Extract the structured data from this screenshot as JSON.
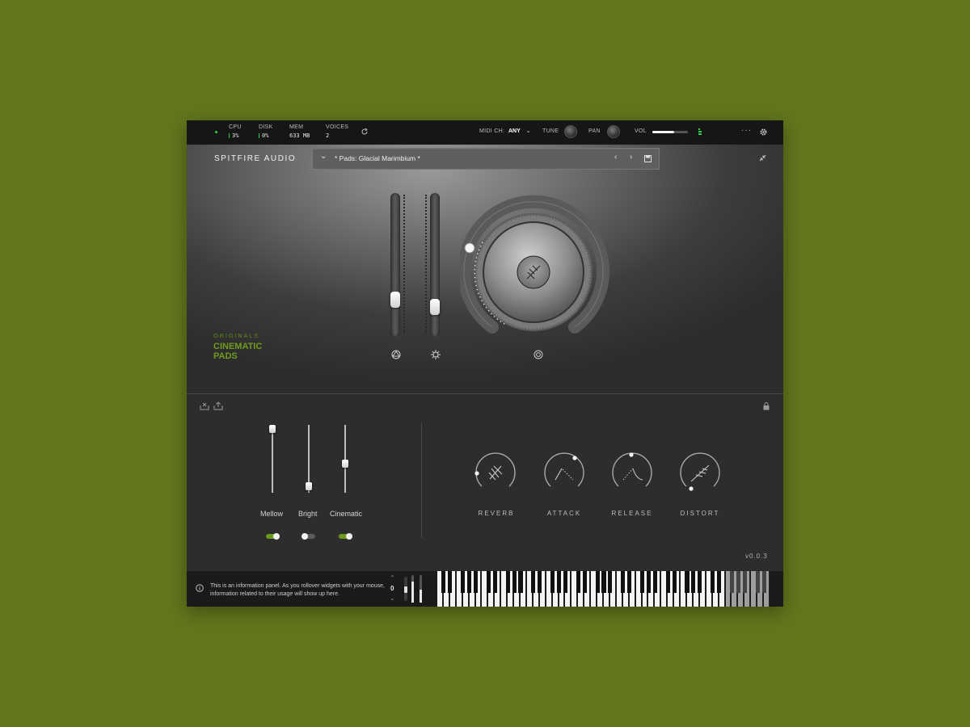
{
  "topbar": {
    "cpu_label": "CPU",
    "cpu_value": "3%",
    "disk_label": "DISK",
    "disk_value": "0%",
    "mem_label": "MEM",
    "mem_value": "633 MB",
    "voices_label": "VOICES",
    "voices_value": "2",
    "midi_label": "MIDI CH:",
    "midi_value": "ANY",
    "tune_label": "TUNE",
    "pan_label": "PAN",
    "vol_label": "VOL",
    "vol_level": 0.62,
    "more_icon": "ellipsis-icon"
  },
  "header": {
    "brand": "SPITFIRE AUDIO",
    "preset_name": "* Pads: Glacial Marimbium *"
  },
  "product": {
    "line1": "ORIGINALS",
    "line2": "CINEMATIC",
    "line3": "PADS"
  },
  "macro_sliders": [
    {
      "name": "expression",
      "level": 0.23
    },
    {
      "name": "dynamics",
      "level": 0.17
    }
  ],
  "mix_sliders": [
    {
      "label": "Mellow",
      "level": 1.0,
      "enabled": true
    },
    {
      "label": "Bright",
      "level": 0.04,
      "enabled": false
    },
    {
      "label": "Cinematic",
      "level": 0.42,
      "enabled": true
    }
  ],
  "effects": [
    {
      "label": "REVERB"
    },
    {
      "label": "ATTACK"
    },
    {
      "label": "RELEASE"
    },
    {
      "label": "DISTORT"
    }
  ],
  "version": "v0.0.3",
  "footer": {
    "info": "This is an information panel. As you rollover widgets with your mouse, information related to their usage will show up here.",
    "octave": "0"
  },
  "colors": {
    "accent_green": "#6c9a1a",
    "meter_green": "#2ed14a",
    "background": "#62761c"
  }
}
